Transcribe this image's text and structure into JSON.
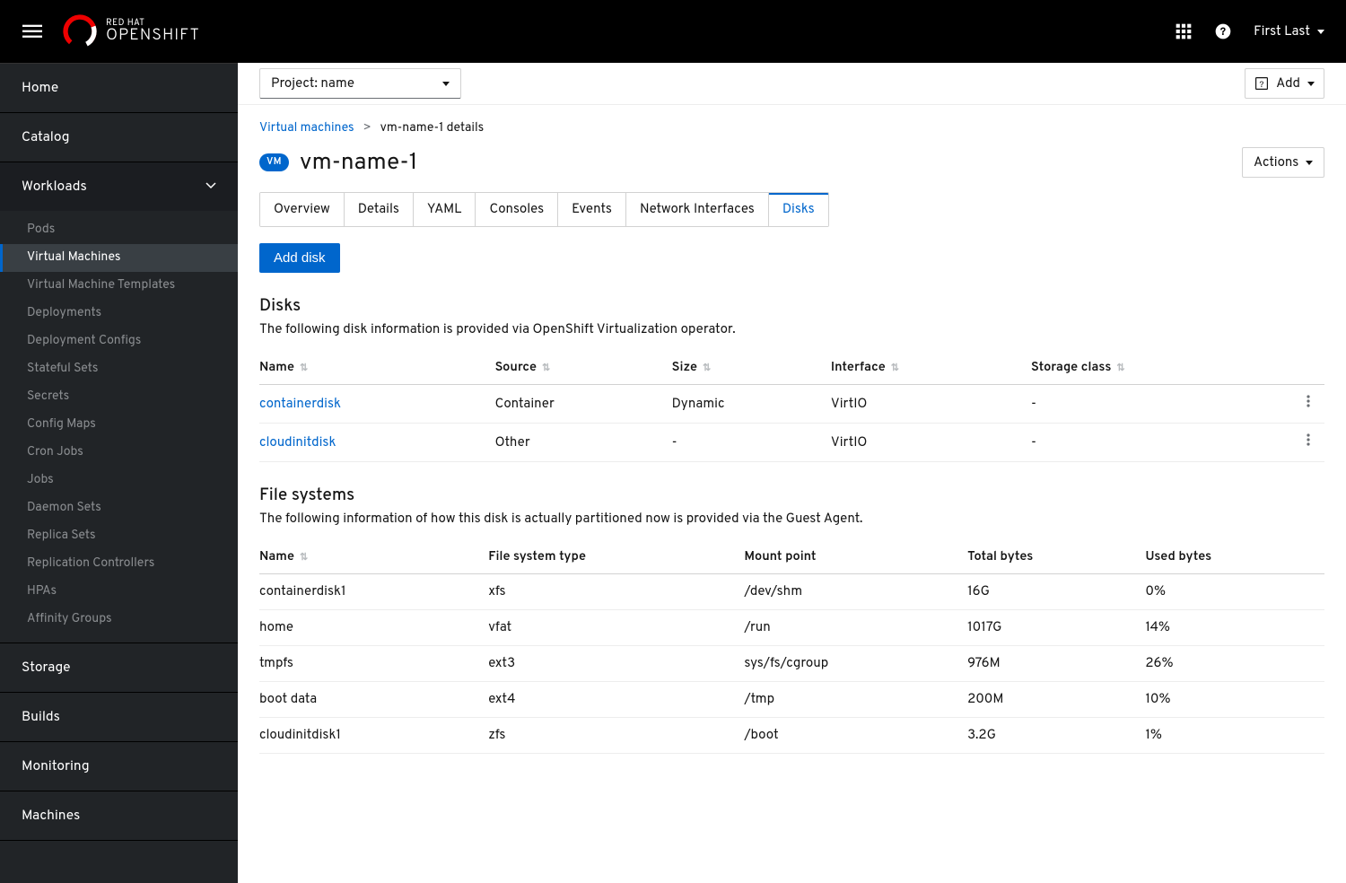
{
  "brand": {
    "top": "RED HAT",
    "bot": "OPENSHIFT"
  },
  "user": {
    "name": "First Last"
  },
  "sidebar": {
    "sections": [
      {
        "label": "Home",
        "expanded": false
      },
      {
        "label": "Catalog",
        "expanded": false
      },
      {
        "label": "Workloads",
        "expanded": true,
        "items": [
          "Pods",
          "Virtual Machines",
          "Virtual Machine Templates",
          "Deployments",
          "Deployment Configs",
          "Stateful Sets",
          "Secrets",
          "Config Maps",
          "Cron Jobs",
          "Jobs",
          "Daemon Sets",
          "Replica Sets",
          "Replication Controllers",
          "HPAs",
          "Affinity Groups"
        ],
        "activeIndex": 1
      },
      {
        "label": "Storage",
        "expanded": false
      },
      {
        "label": "Builds",
        "expanded": false
      },
      {
        "label": "Monitoring",
        "expanded": false
      },
      {
        "label": "Machines",
        "expanded": false
      }
    ]
  },
  "toolbar": {
    "project_label": "Project: name",
    "add_label": "Add"
  },
  "breadcrumb": {
    "parent": "Virtual machines",
    "current": "vm-name-1 details"
  },
  "page": {
    "badge": "VM",
    "title": "vm-name-1",
    "actions_label": "Actions"
  },
  "tabs": [
    "Overview",
    "Details",
    "YAML",
    "Consoles",
    "Events",
    "Network Interfaces",
    "Disks"
  ],
  "active_tab_index": 6,
  "add_disk_label": "Add disk",
  "disks": {
    "heading": "Disks",
    "desc": "The following disk information is provided via OpenShift Virtualization operator.",
    "columns": [
      "Name",
      "Source",
      "Size",
      "Interface",
      "Storage class"
    ],
    "rows": [
      {
        "name": "containerdisk",
        "source": "Container",
        "size": "Dynamic",
        "interface": "VirtIO",
        "storage": "-"
      },
      {
        "name": "cloudinitdisk",
        "source": "Other",
        "size": "-",
        "interface": "VirtIO",
        "storage": "-"
      }
    ]
  },
  "fs": {
    "heading": "File systems",
    "desc": "The following information of how this disk is actually partitioned now is provided via the Guest Agent.",
    "columns": [
      "Name",
      "File system type",
      "Mount point",
      "Total bytes",
      "Used bytes"
    ],
    "rows": [
      {
        "name": "containerdisk1",
        "type": "xfs",
        "mount": "/dev/shm",
        "total": "16G",
        "used": "0%"
      },
      {
        "name": "home",
        "type": "vfat",
        "mount": "/run",
        "total": "1017G",
        "used": "14%"
      },
      {
        "name": "tmpfs",
        "type": "ext3",
        "mount": "sys/fs/cgroup",
        "total": "976M",
        "used": "26%"
      },
      {
        "name": "boot data",
        "type": "ext4",
        "mount": "/tmp",
        "total": "200M",
        "used": "10%"
      },
      {
        "name": "cloudinitdisk1",
        "type": "zfs",
        "mount": "/boot",
        "total": "3.2G",
        "used": "1%"
      }
    ]
  }
}
